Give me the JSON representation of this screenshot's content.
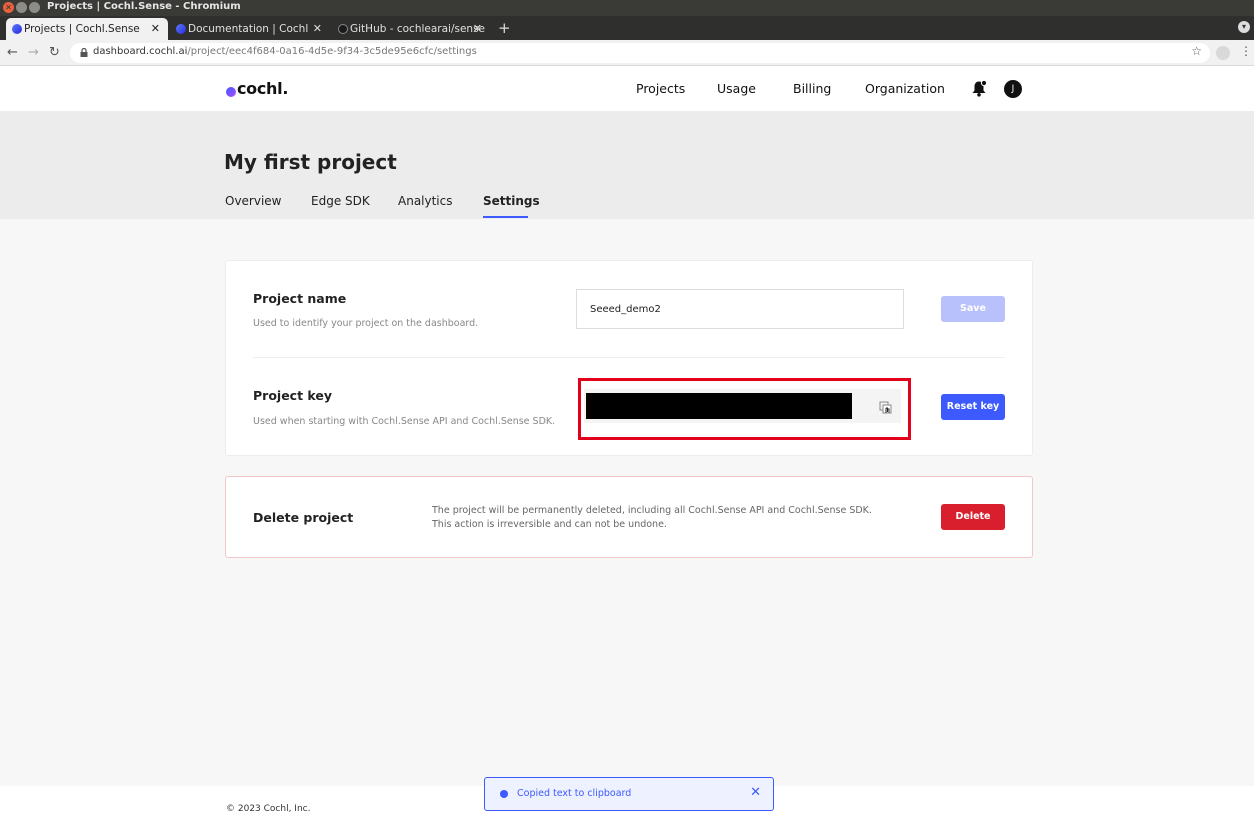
{
  "window": {
    "title": "Projects | Cochl.Sense - Chromium"
  },
  "tabs": [
    {
      "label": "Projects | Cochl.Sense",
      "active": true
    },
    {
      "label": "Documentation | Cochl",
      "active": false
    },
    {
      "label": "GitHub - cochlearai/sense",
      "active": false
    }
  ],
  "address": {
    "host": "dashboard.cochl.ai",
    "path": "/project/eec4f684-0a16-4d5e-9f34-3c5de95e6cfc/settings"
  },
  "header": {
    "brand": "cochl.",
    "nav": [
      "Projects",
      "Usage",
      "Billing",
      "Organization"
    ],
    "avatar_initial": "J"
  },
  "project": {
    "title": "My first project",
    "tabs": [
      "Overview",
      "Edge SDK",
      "Analytics",
      "Settings"
    ],
    "active_tab": "Settings"
  },
  "settings": {
    "name_title": "Project name",
    "name_desc": "Used to identify your project on the dashboard.",
    "name_value": "Seeed_demo2",
    "save_label": "Save",
    "key_title": "Project key",
    "key_desc": "Used when starting with Cochl.Sense API and Cochl.Sense SDK.",
    "reset_label": "Reset key"
  },
  "delete": {
    "title": "Delete project",
    "line1": "The project will be permanently deleted, including all Cochl.Sense API and Cochl.Sense SDK.",
    "line2": "This action is irreversible and can not be undone.",
    "button": "Delete"
  },
  "footer": {
    "copyright": "© 2023 Cochl, Inc."
  },
  "toast": {
    "message": "Copied text to clipboard"
  },
  "colors": {
    "accent": "#3d5afe",
    "danger": "#d91f2e",
    "highlight": "#e3001b"
  }
}
